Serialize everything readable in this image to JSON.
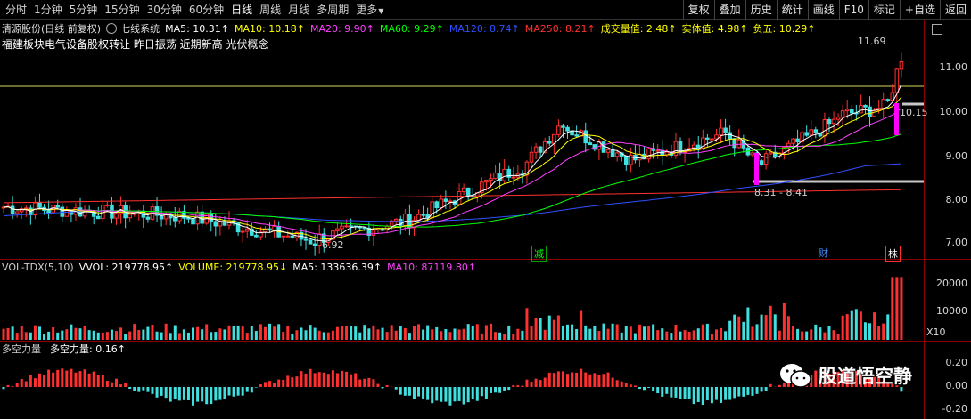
{
  "toolbar": {
    "tabs": [
      "分时",
      "1分钟",
      "5分钟",
      "15分钟",
      "30分钟",
      "60分钟",
      "日线",
      "周线",
      "月线",
      "多周期",
      "更多"
    ],
    "active_tab": "日线",
    "buttons": [
      "复权",
      "叠加",
      "历史",
      "统计",
      "画线",
      "F10",
      "标记",
      "+自选",
      "返回"
    ]
  },
  "main": {
    "stock_title": "清源股份(日线 前复权)",
    "system_name": "七线系统",
    "ma": [
      {
        "label": "MA5: 10.31↑",
        "color": "#ffffff"
      },
      {
        "label": "MA10: 10.18↑",
        "color": "#ffff00"
      },
      {
        "label": "MA20: 9.90↑",
        "color": "#ff40ff"
      },
      {
        "label": "MA60: 9.29↑",
        "color": "#00ff00"
      },
      {
        "label": "MA120: 8.74↑",
        "color": "#3050ff"
      },
      {
        "label": "MA250: 8.21↑",
        "color": "#ff3030"
      },
      {
        "label": "成交量值: 2.48↑",
        "color": "#ffff00"
      },
      {
        "label": "实体值: 4.98↑",
        "color": "#ffff00"
      },
      {
        "label": "负五: 10.29↑",
        "color": "#ffff00"
      }
    ],
    "note": "福建板块电气设备股权转让 昨日振荡 近期新高 光伏概念",
    "y_labels": [
      "11.00",
      "10.00",
      "9.00",
      "8.00",
      "7.00"
    ],
    "annotations": {
      "high": "11.69",
      "low": "6.92",
      "range": "8.31 - 8.41",
      "right_val": "10.15"
    },
    "markers": [
      {
        "text": "减",
        "color": "#00ff00"
      },
      {
        "text": "财",
        "color": "#3c8cff"
      },
      {
        "text": "株",
        "color": "#ffffff"
      }
    ]
  },
  "volume": {
    "title": "VOL-TDX(5,10)",
    "vvol": "VVOL: 219778.95↑",
    "volume": "VOLUME: 219778.95↓",
    "ma5": "MA5: 133636.39↑",
    "ma10": "MA10: 87119.80↑",
    "y_labels": [
      "20000",
      "10000"
    ],
    "unit": "X10"
  },
  "dkl": {
    "title": "多空力量",
    "value": "多空力量: 0.16↑",
    "y_labels": [
      "0.20",
      "0.00",
      "-0.20"
    ]
  },
  "watermark": {
    "text": "股道悟空静"
  },
  "colors": {
    "up": "#ff3030",
    "down": "#40e0e0",
    "frame": "#8a0000"
  }
}
